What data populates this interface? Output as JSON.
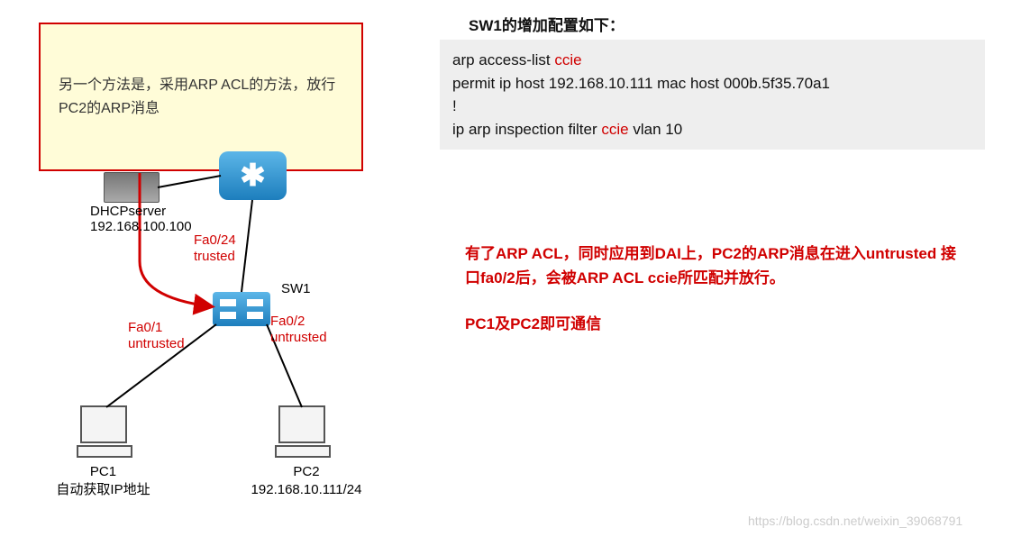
{
  "note": {
    "text": "另一个方法是，采用ARP ACL的方法，放行PC2的ARP消息"
  },
  "config": {
    "title": "SW1的增加配置如下：",
    "line1a": "arp access-list ",
    "line1b": "ccie",
    "line2": " permit ip host 192.168.10.111 mac host 000b.5f35.70a1",
    "line3": "!",
    "line4a": "ip arp inspection filter ",
    "line4b": "ccie",
    "line4c": " vlan  10"
  },
  "explain": {
    "p1": "有了ARP ACL，同时应用到DAI上，PC2的ARP消息在进入untrusted 接口fa0/2后，会被ARP ACL ccie所匹配并放行。",
    "p2": "PC1及PC2即可通信"
  },
  "diagram": {
    "dhcp_name": "DHCPserver",
    "dhcp_ip": "192.168.100.100",
    "sw_name": "SW1",
    "port24_if": "Fa0/24",
    "port24_state": "trusted",
    "port1_if": "Fa0/1",
    "port1_state": "untrusted",
    "port2_if": "Fa0/2",
    "port2_state": "untrusted",
    "pc1_name": "PC1",
    "pc1_ip": "自动获取IP地址",
    "pc2_name": "PC2",
    "pc2_ip": "192.168.10.111/24"
  },
  "watermark": "https://blog.csdn.net/weixin_39068791"
}
